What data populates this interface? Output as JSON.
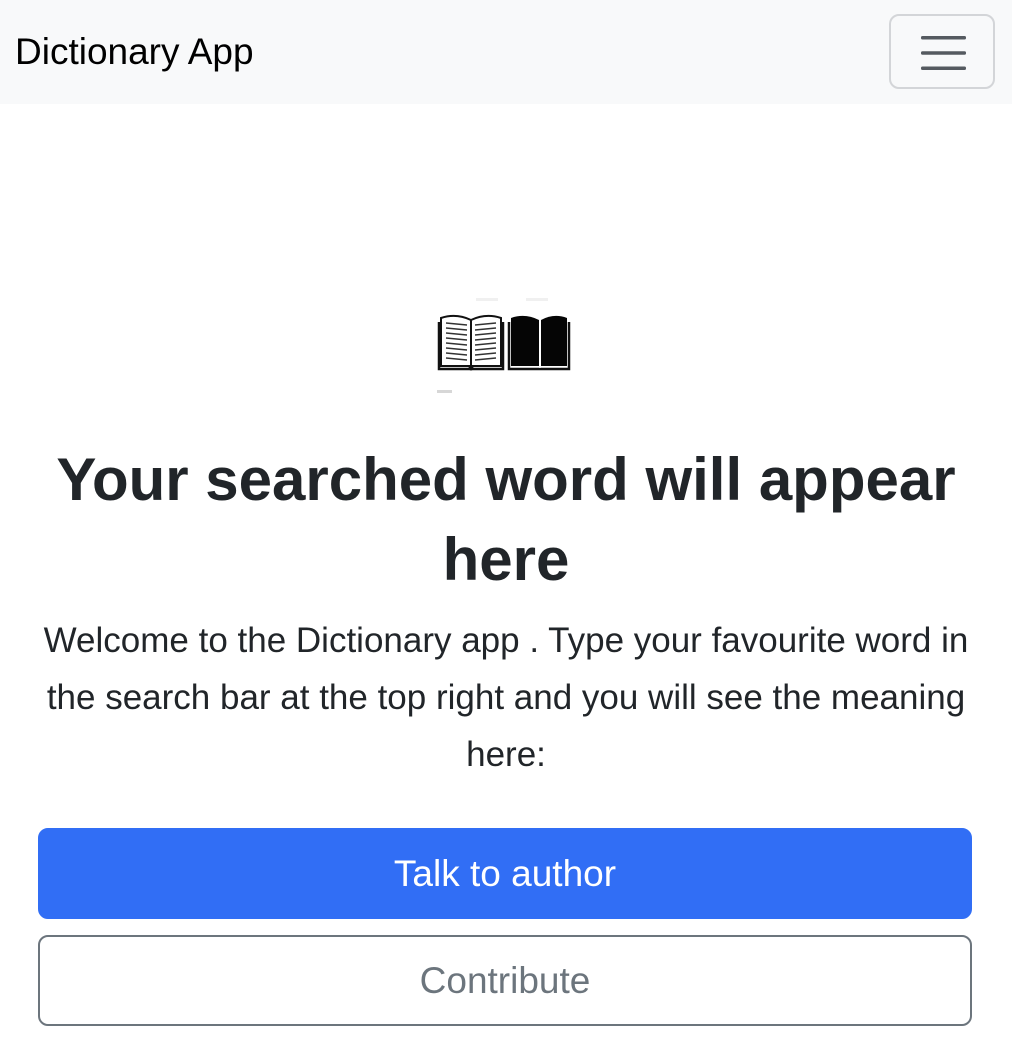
{
  "navbar": {
    "brand": "Dictionary App",
    "toggler_icon": "hamburger-menu-icon"
  },
  "hero": {
    "image_icon": "open-book-icon",
    "title": "Your searched word will appear here",
    "description": "Welcome to the Dictionary app . Type your favourite word in the search bar at the top right and you will see the meaning here:"
  },
  "actions": {
    "primary_label": "Talk to author",
    "secondary_label": "Contribute"
  },
  "colors": {
    "navbar_bg": "#f8f9fa",
    "primary": "#316ef5",
    "secondary": "#6c757d",
    "text": "#212529"
  }
}
